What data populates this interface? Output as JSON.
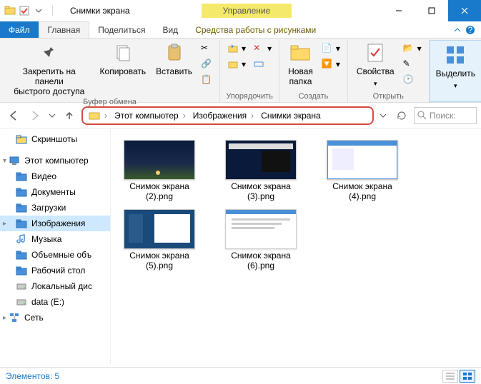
{
  "titlebar": {
    "title": "Снимки экрана",
    "context_tab": "Управление"
  },
  "ribbon": {
    "file": "Файл",
    "tabs": [
      "Главная",
      "Поделиться",
      "Вид"
    ],
    "context_tabs": [
      "Средства работы с рисунками"
    ],
    "pin": "Закрепить на панели\nбыстрого доступа",
    "copy": "Копировать",
    "paste": "Вставить",
    "group_clipboard": "Буфер обмена",
    "new_folder": "Новая\nпапка",
    "group_organize": "Упорядочить",
    "group_create": "Создать",
    "properties": "Свойства",
    "group_open": "Открыть",
    "select": "Выделить"
  },
  "breadcrumb": {
    "items": [
      "Этот компьютер",
      "Изображения",
      "Снимки экрана"
    ]
  },
  "search": {
    "placeholder": "Поиск: "
  },
  "sidebar": {
    "items": [
      {
        "label": "Скриншоты",
        "icon": "folder",
        "root": false
      },
      {
        "label": "Этот компьютер",
        "icon": "pc",
        "root": true,
        "exp": "▾"
      },
      {
        "label": "Видео",
        "icon": "video",
        "root": false
      },
      {
        "label": "Документы",
        "icon": "docs",
        "root": false
      },
      {
        "label": "Загрузки",
        "icon": "downloads",
        "root": false
      },
      {
        "label": "Изображения",
        "icon": "pictures",
        "root": false,
        "selected": true,
        "exp": "▸"
      },
      {
        "label": "Музыка",
        "icon": "music",
        "root": false
      },
      {
        "label": "Объемные объ",
        "icon": "3d",
        "root": false
      },
      {
        "label": "Рабочий стол",
        "icon": "desktop",
        "root": false
      },
      {
        "label": "Локальный дис",
        "icon": "disk",
        "root": false
      },
      {
        "label": "data (E:)",
        "icon": "disk",
        "root": false
      },
      {
        "label": "Сеть",
        "icon": "network",
        "root": true,
        "exp": "▸"
      }
    ]
  },
  "files": [
    {
      "name": "Снимок экрана (2).png",
      "kind": "dark"
    },
    {
      "name": "Снимок экрана (3).png",
      "kind": "dark-window"
    },
    {
      "name": "Снимок экрана (4).png",
      "kind": "light-window"
    },
    {
      "name": "Снимок экрана (5).png",
      "kind": "blue-window"
    },
    {
      "name": "Снимок экрана (6).png",
      "kind": "doc"
    }
  ],
  "status": {
    "text": "Элементов: 5"
  }
}
